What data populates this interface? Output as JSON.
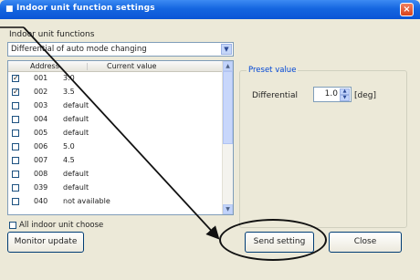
{
  "window": {
    "title": "Indoor unit function settings",
    "close_glyph": "×"
  },
  "functions": {
    "label": "Indoor unit functions",
    "selected": "Differential of auto mode changing"
  },
  "table": {
    "headers": [
      "Address",
      "Current value"
    ],
    "rows": [
      {
        "checked": "✓",
        "address": "001",
        "value": "3.0"
      },
      {
        "checked": "✓",
        "address": "002",
        "value": "3.5"
      },
      {
        "checked": "",
        "address": "003",
        "value": "default"
      },
      {
        "checked": "",
        "address": "004",
        "value": "default"
      },
      {
        "checked": "",
        "address": "005",
        "value": "default"
      },
      {
        "checked": "",
        "address": "006",
        "value": "5.0"
      },
      {
        "checked": "",
        "address": "007",
        "value": "4.5"
      },
      {
        "checked": "",
        "address": "008",
        "value": "default"
      },
      {
        "checked": "",
        "address": "039",
        "value": "default"
      },
      {
        "checked": "",
        "address": "040",
        "value": "not available"
      }
    ]
  },
  "all_choose_label": "All indoor unit choose",
  "preset": {
    "group_label": "Preset value",
    "differential_label": "Differential",
    "value": "1.0",
    "unit": "[deg]"
  },
  "buttons": {
    "monitor": "Monitor update",
    "send": "Send setting",
    "close": "Close"
  },
  "colors": {
    "title_bar": "#0b55d6",
    "group_label": "#0046d5"
  }
}
